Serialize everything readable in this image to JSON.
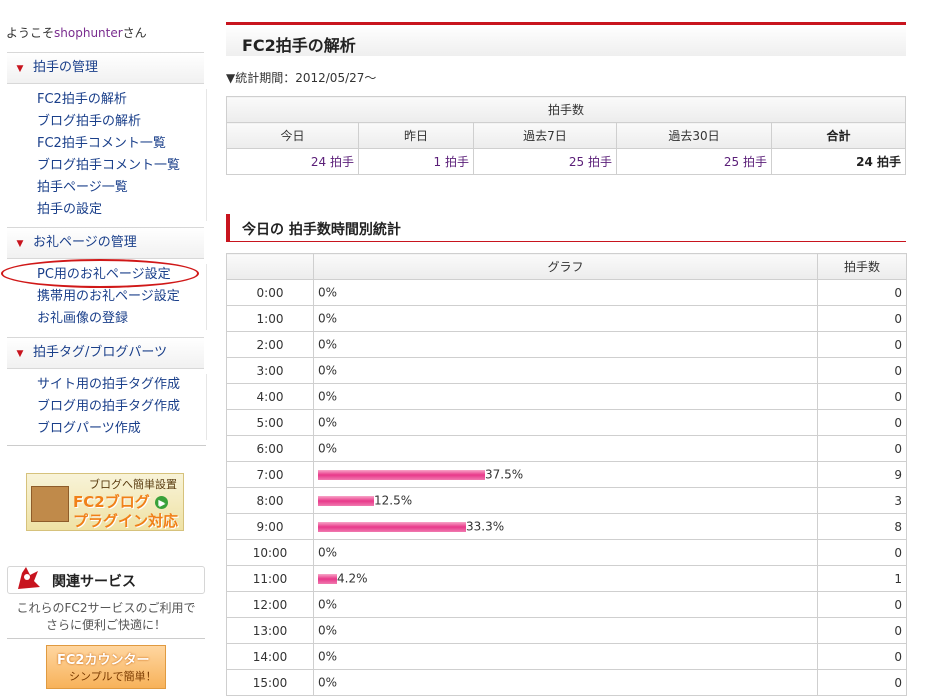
{
  "welcome": {
    "prefix": "ようこそ",
    "user": "shophunter",
    "suffix": "さん"
  },
  "sidebar": {
    "sections": [
      {
        "title": "拍手の管理",
        "items": [
          "FC2拍手の解析",
          "ブログ拍手の解析",
          "FC2拍手コメント一覧",
          "ブログ拍手コメント一覧",
          "拍手ページ一覧",
          "拍手の設定"
        ]
      },
      {
        "title": "お礼ページの管理",
        "items": [
          "PC用のお礼ページ設定",
          "携帯用のお礼ページ設定",
          "お礼画像の登録"
        ]
      },
      {
        "title": "拍手タグ/ブログパーツ",
        "items": [
          "サイト用の拍手タグ作成",
          "ブログ用の拍手タグ作成",
          "ブログパーツ作成"
        ]
      }
    ],
    "banner": {
      "top": "ブログへ簡単設置",
      "main": "FC2ブログ",
      "sub": "プラグイン対応"
    },
    "related": {
      "title": "関連サービス",
      "desc_line1": "これらのFC2サービスのご利用で",
      "desc_line2": "さらに便利ご快適に！"
    },
    "counter_banner": {
      "title": "FC2カウンター",
      "sub": "シンプルで簡単！"
    }
  },
  "main": {
    "title": "FC2拍手の解析",
    "period": "▼統計期間：2012/05/27〜",
    "summary": {
      "caption": "拍手数",
      "headers": [
        "今日",
        "昨日",
        "過去7日",
        "過去30日",
        "合計"
      ],
      "values": [
        "24 拍手",
        "1 拍手",
        "25 拍手",
        "25 拍手",
        "24 拍手"
      ]
    },
    "hourly": {
      "title": "今日の 拍手数時間別統計",
      "headers": [
        "",
        "グラフ",
        "拍手数"
      ],
      "rows": [
        {
          "time": "0:00",
          "pct": "0%",
          "frac": 0,
          "count": "0"
        },
        {
          "time": "1:00",
          "pct": "0%",
          "frac": 0,
          "count": "0"
        },
        {
          "time": "2:00",
          "pct": "0%",
          "frac": 0,
          "count": "0"
        },
        {
          "time": "3:00",
          "pct": "0%",
          "frac": 0,
          "count": "0"
        },
        {
          "time": "4:00",
          "pct": "0%",
          "frac": 0,
          "count": "0"
        },
        {
          "time": "5:00",
          "pct": "0%",
          "frac": 0,
          "count": "0"
        },
        {
          "time": "6:00",
          "pct": "0%",
          "frac": 0,
          "count": "0"
        },
        {
          "time": "7:00",
          "pct": "37.5%",
          "frac": 0.375,
          "count": "9"
        },
        {
          "time": "8:00",
          "pct": "12.5%",
          "frac": 0.125,
          "count": "3"
        },
        {
          "time": "9:00",
          "pct": "33.3%",
          "frac": 0.333,
          "count": "8"
        },
        {
          "time": "10:00",
          "pct": "0%",
          "frac": 0,
          "count": "0"
        },
        {
          "time": "11:00",
          "pct": "4.2%",
          "frac": 0.042,
          "count": "1"
        },
        {
          "time": "12:00",
          "pct": "0%",
          "frac": 0,
          "count": "0"
        },
        {
          "time": "13:00",
          "pct": "0%",
          "frac": 0,
          "count": "0"
        },
        {
          "time": "14:00",
          "pct": "0%",
          "frac": 0,
          "count": "0"
        },
        {
          "time": "15:00",
          "pct": "0%",
          "frac": 0,
          "count": "0"
        }
      ]
    }
  }
}
